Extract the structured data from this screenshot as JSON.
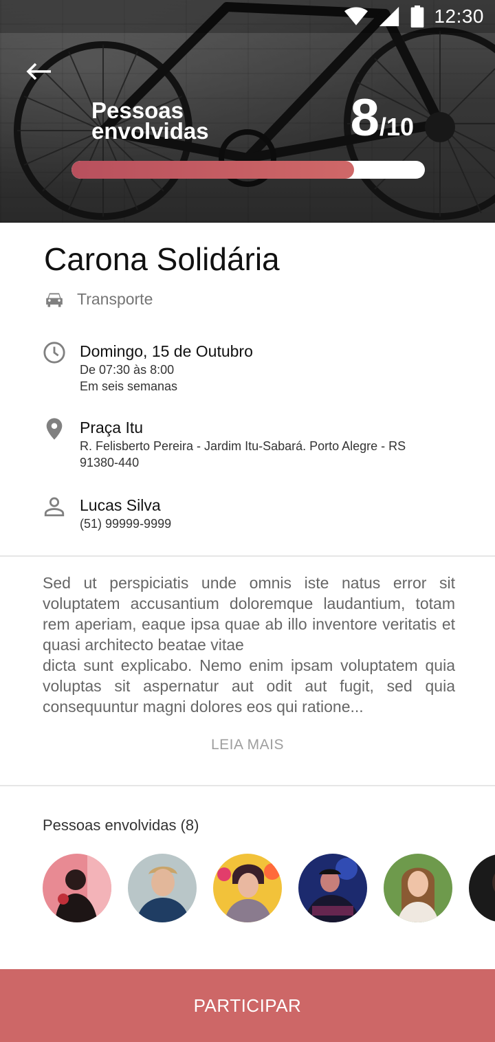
{
  "status_bar": {
    "time": "12:30",
    "icons": [
      "wifi-icon",
      "signal-icon",
      "battery-icon"
    ]
  },
  "header": {
    "back_icon": "arrow-left-icon",
    "people_label": "Pessoas envolvidas",
    "people_count": "8",
    "people_total": "/10",
    "progress": 0.8,
    "progress_color": "#cd6767"
  },
  "event": {
    "title": "Carona Solidária",
    "category": {
      "icon": "car-icon",
      "label": "Transporte"
    },
    "date": {
      "icon": "clock-icon",
      "main": "Domingo, 15 de Outubro",
      "time": "De 07:30 às 8:00",
      "relative": "Em seis semanas"
    },
    "location": {
      "icon": "location-pin-icon",
      "main": "Praça Itu",
      "address_line1": "R. Felisberto Pereira - Jardim Itu-Sabará. Porto Alegre - RS",
      "address_line2": "91380-440"
    },
    "organizer": {
      "icon": "person-icon",
      "name": "Lucas Silva",
      "phone": "(51) 99999-9999"
    },
    "description_p1": "Sed ut perspiciatis unde omnis iste natus error sit voluptatem accusantium doloremque laudantium, totam rem aperiam, eaque ipsa quae ab illo inventore veritatis et quasi architecto beatae vitae",
    "description_p2": "dicta sunt explicabo. Nemo enim ipsam voluptatem quia voluptas sit aspernatur aut odit aut fugit, sed quia consequuntur magni dolores eos qui ratione...",
    "read_more": "LEIA MAIS"
  },
  "participants": {
    "title": "Pessoas envolvidas (8)",
    "avatars": [
      "avatar-1",
      "avatar-2",
      "avatar-3",
      "avatar-4",
      "avatar-5",
      "avatar-6"
    ]
  },
  "cta": {
    "label": "PARTICIPAR"
  },
  "colors": {
    "accent": "#cd6767",
    "text_primary": "#111111",
    "text_secondary": "#757575"
  }
}
